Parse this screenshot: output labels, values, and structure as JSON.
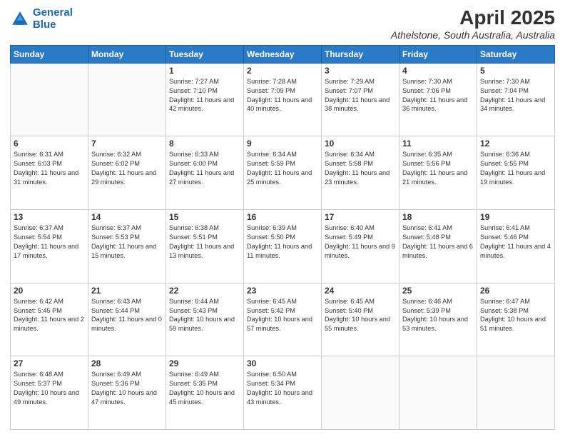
{
  "logo": {
    "line1": "General",
    "line2": "Blue"
  },
  "title": "April 2025",
  "subtitle": "Athelstone, South Australia, Australia",
  "days_of_week": [
    "Sunday",
    "Monday",
    "Tuesday",
    "Wednesday",
    "Thursday",
    "Friday",
    "Saturday"
  ],
  "weeks": [
    [
      {
        "day": "",
        "info": ""
      },
      {
        "day": "",
        "info": ""
      },
      {
        "day": "1",
        "info": "Sunrise: 7:27 AM\nSunset: 7:10 PM\nDaylight: 11 hours and 42 minutes."
      },
      {
        "day": "2",
        "info": "Sunrise: 7:28 AM\nSunset: 7:09 PM\nDaylight: 11 hours and 40 minutes."
      },
      {
        "day": "3",
        "info": "Sunrise: 7:29 AM\nSunset: 7:07 PM\nDaylight: 11 hours and 38 minutes."
      },
      {
        "day": "4",
        "info": "Sunrise: 7:30 AM\nSunset: 7:06 PM\nDaylight: 11 hours and 36 minutes."
      },
      {
        "day": "5",
        "info": "Sunrise: 7:30 AM\nSunset: 7:04 PM\nDaylight: 11 hours and 34 minutes."
      }
    ],
    [
      {
        "day": "6",
        "info": "Sunrise: 6:31 AM\nSunset: 6:03 PM\nDaylight: 11 hours and 31 minutes."
      },
      {
        "day": "7",
        "info": "Sunrise: 6:32 AM\nSunset: 6:02 PM\nDaylight: 11 hours and 29 minutes."
      },
      {
        "day": "8",
        "info": "Sunrise: 6:33 AM\nSunset: 6:00 PM\nDaylight: 11 hours and 27 minutes."
      },
      {
        "day": "9",
        "info": "Sunrise: 6:34 AM\nSunset: 5:59 PM\nDaylight: 11 hours and 25 minutes."
      },
      {
        "day": "10",
        "info": "Sunrise: 6:34 AM\nSunset: 5:58 PM\nDaylight: 11 hours and 23 minutes."
      },
      {
        "day": "11",
        "info": "Sunrise: 6:35 AM\nSunset: 5:56 PM\nDaylight: 11 hours and 21 minutes."
      },
      {
        "day": "12",
        "info": "Sunrise: 6:36 AM\nSunset: 5:55 PM\nDaylight: 11 hours and 19 minutes."
      }
    ],
    [
      {
        "day": "13",
        "info": "Sunrise: 6:37 AM\nSunset: 5:54 PM\nDaylight: 11 hours and 17 minutes."
      },
      {
        "day": "14",
        "info": "Sunrise: 6:37 AM\nSunset: 5:53 PM\nDaylight: 11 hours and 15 minutes."
      },
      {
        "day": "15",
        "info": "Sunrise: 6:38 AM\nSunset: 5:51 PM\nDaylight: 11 hours and 13 minutes."
      },
      {
        "day": "16",
        "info": "Sunrise: 6:39 AM\nSunset: 5:50 PM\nDaylight: 11 hours and 11 minutes."
      },
      {
        "day": "17",
        "info": "Sunrise: 6:40 AM\nSunset: 5:49 PM\nDaylight: 11 hours and 9 minutes."
      },
      {
        "day": "18",
        "info": "Sunrise: 6:41 AM\nSunset: 5:48 PM\nDaylight: 11 hours and 6 minutes."
      },
      {
        "day": "19",
        "info": "Sunrise: 6:41 AM\nSunset: 5:46 PM\nDaylight: 11 hours and 4 minutes."
      }
    ],
    [
      {
        "day": "20",
        "info": "Sunrise: 6:42 AM\nSunset: 5:45 PM\nDaylight: 11 hours and 2 minutes."
      },
      {
        "day": "21",
        "info": "Sunrise: 6:43 AM\nSunset: 5:44 PM\nDaylight: 11 hours and 0 minutes."
      },
      {
        "day": "22",
        "info": "Sunrise: 6:44 AM\nSunset: 5:43 PM\nDaylight: 10 hours and 59 minutes."
      },
      {
        "day": "23",
        "info": "Sunrise: 6:45 AM\nSunset: 5:42 PM\nDaylight: 10 hours and 57 minutes."
      },
      {
        "day": "24",
        "info": "Sunrise: 6:45 AM\nSunset: 5:40 PM\nDaylight: 10 hours and 55 minutes."
      },
      {
        "day": "25",
        "info": "Sunrise: 6:46 AM\nSunset: 5:39 PM\nDaylight: 10 hours and 53 minutes."
      },
      {
        "day": "26",
        "info": "Sunrise: 6:47 AM\nSunset: 5:38 PM\nDaylight: 10 hours and 51 minutes."
      }
    ],
    [
      {
        "day": "27",
        "info": "Sunrise: 6:48 AM\nSunset: 5:37 PM\nDaylight: 10 hours and 49 minutes."
      },
      {
        "day": "28",
        "info": "Sunrise: 6:49 AM\nSunset: 5:36 PM\nDaylight: 10 hours and 47 minutes."
      },
      {
        "day": "29",
        "info": "Sunrise: 6:49 AM\nSunset: 5:35 PM\nDaylight: 10 hours and 45 minutes."
      },
      {
        "day": "30",
        "info": "Sunrise: 6:50 AM\nSunset: 5:34 PM\nDaylight: 10 hours and 43 minutes."
      },
      {
        "day": "",
        "info": ""
      },
      {
        "day": "",
        "info": ""
      },
      {
        "day": "",
        "info": ""
      }
    ]
  ]
}
